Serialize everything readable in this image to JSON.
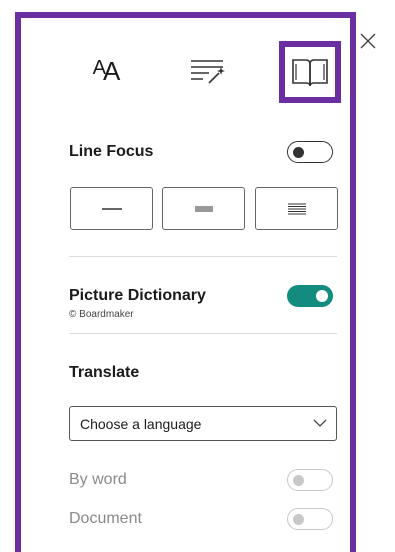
{
  "tabs": {
    "text_size": {
      "glyph_large": "A",
      "glyph_small": "A",
      "icon": "text-size-icon"
    },
    "grammar": {
      "icon": "grammar-options-icon"
    },
    "reading": {
      "icon": "book-icon",
      "selected": true
    }
  },
  "close": {
    "icon": "close-icon"
  },
  "line_focus": {
    "label": "Line Focus",
    "enabled": false,
    "options": [
      {
        "icon": "one-line-icon"
      },
      {
        "icon": "three-lines-icon"
      },
      {
        "icon": "five-lines-icon"
      }
    ]
  },
  "picture_dictionary": {
    "label": "Picture Dictionary",
    "credit": "© Boardmaker",
    "enabled": true,
    "accent": "#138b7f"
  },
  "translate": {
    "heading": "Translate",
    "select_value": "Choose a language",
    "by_word_label": "By word",
    "by_word_enabled": false,
    "document_label": "Document",
    "document_enabled": false
  },
  "colors": {
    "border": "#6b2fa2",
    "disabled_text": "#8a8a8a"
  }
}
